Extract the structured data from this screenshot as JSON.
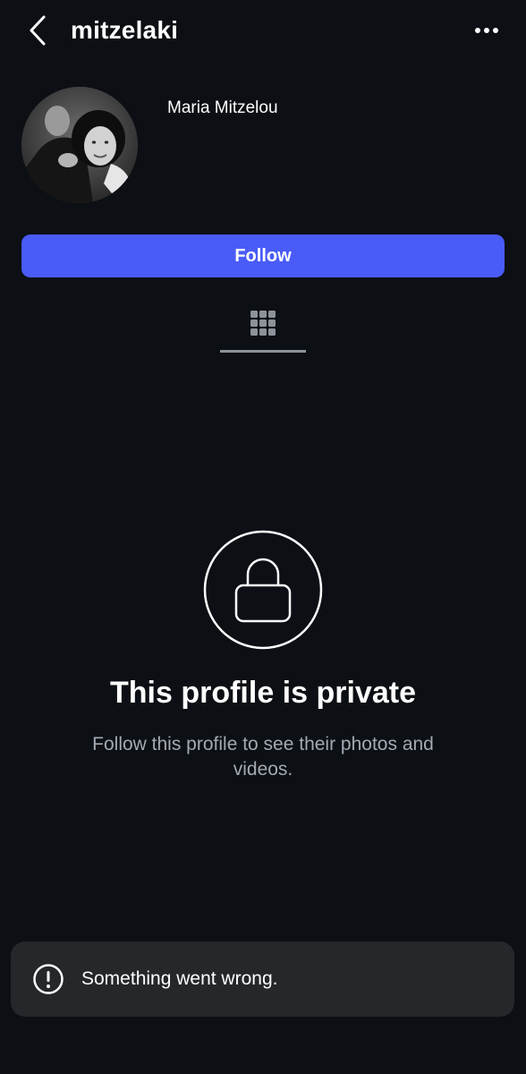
{
  "header": {
    "username": "mitzelaki",
    "back_icon": "chevron-left-icon",
    "more_icon": "more-horizontal-icon"
  },
  "profile": {
    "display_name": "Maria Mitzelou",
    "avatar_icon": "profile-photo"
  },
  "actions": {
    "follow_label": "Follow",
    "follow_color": "#4a5cf7"
  },
  "tabs": {
    "grid_icon": "grid-icon"
  },
  "private_notice": {
    "icon": "lock-icon",
    "title": "This profile is private",
    "subtitle": "Follow this profile to see their photos and videos."
  },
  "toast": {
    "icon": "exclamation-circle-icon",
    "message": "Something went wrong."
  },
  "colors": {
    "background": "#0c0f14",
    "toast_background": "#25272b",
    "secondary_text": "#a4a9b4"
  }
}
